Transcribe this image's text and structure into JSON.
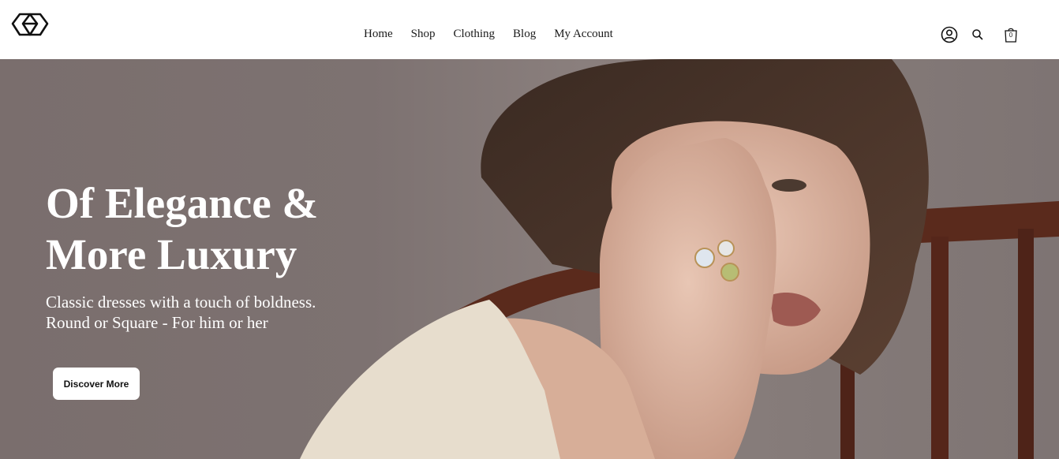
{
  "header": {
    "logo_icon": "geometric-logo-icon",
    "nav": [
      "Home",
      "Shop",
      "Clothing",
      "Blog",
      "My Account"
    ],
    "icons": {
      "account": "user-circle-icon",
      "search": "search-icon",
      "cart": "shopping-bag-icon",
      "cart_count": "0"
    }
  },
  "hero": {
    "title": "Of Elegance & More Luxury",
    "subtitle_lines": [
      "Classic dresses with a touch of boldness.",
      "Round or Square - For him or her"
    ],
    "cta_label": "Discover More",
    "image": "woman-wearing-rings-photo"
  },
  "colors": {
    "hero_background": "#7d7271",
    "text_light": "#ffffff",
    "text_dark": "#1a1a1a"
  }
}
